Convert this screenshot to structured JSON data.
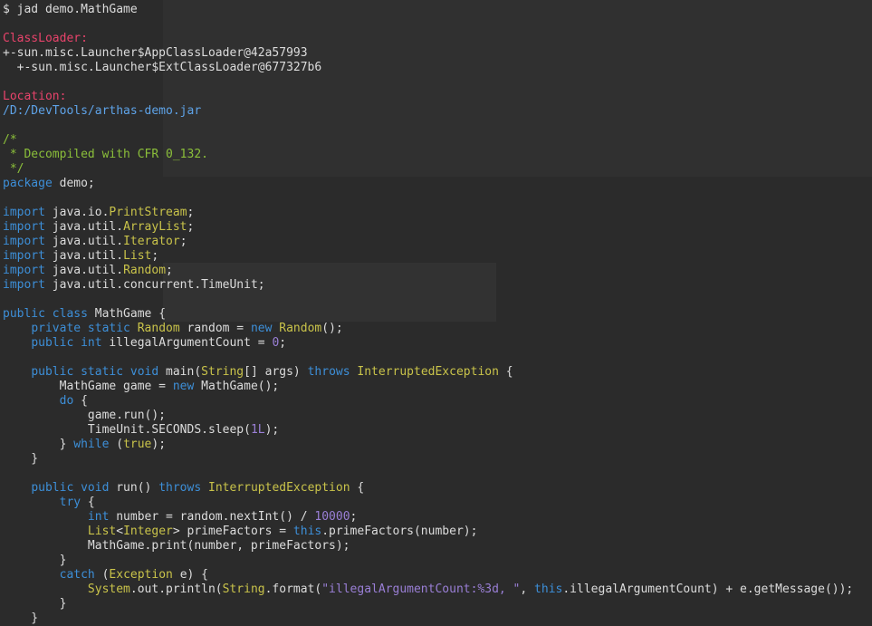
{
  "terminal": {
    "lines": [
      [
        {
          "t": "$ jad demo.MathGame",
          "c": "text"
        }
      ],
      [],
      [
        {
          "t": "ClassLoader:",
          "c": "label"
        }
      ],
      [
        {
          "t": "+-sun.misc.Launcher$AppClassLoader@42a57993",
          "c": "text"
        }
      ],
      [
        {
          "t": "  +-sun.misc.Launcher$ExtClassLoader@677327b6",
          "c": "text"
        }
      ],
      [],
      [
        {
          "t": "Location:",
          "c": "label"
        }
      ],
      [
        {
          "t": "/D:/DevTools/arthas-demo.jar",
          "c": "path"
        }
      ],
      [],
      [
        {
          "t": "/*",
          "c": "comment"
        }
      ],
      [
        {
          "t": " * Decompiled with CFR 0_132.",
          "c": "comment"
        }
      ],
      [
        {
          "t": " */",
          "c": "comment"
        }
      ],
      [
        {
          "t": "package",
          "c": "kw"
        },
        {
          "t": " demo;",
          "c": "text"
        }
      ],
      [],
      [
        {
          "t": "import",
          "c": "kw"
        },
        {
          "t": " java.io.",
          "c": "text"
        },
        {
          "t": "PrintStream",
          "c": "type"
        },
        {
          "t": ";",
          "c": "text"
        }
      ],
      [
        {
          "t": "import",
          "c": "kw"
        },
        {
          "t": " java.util.",
          "c": "text"
        },
        {
          "t": "ArrayList",
          "c": "type"
        },
        {
          "t": ";",
          "c": "text"
        }
      ],
      [
        {
          "t": "import",
          "c": "kw"
        },
        {
          "t": " java.util.",
          "c": "text"
        },
        {
          "t": "Iterator",
          "c": "type"
        },
        {
          "t": ";",
          "c": "text"
        }
      ],
      [
        {
          "t": "import",
          "c": "kw"
        },
        {
          "t": " java.util.",
          "c": "text"
        },
        {
          "t": "List",
          "c": "type"
        },
        {
          "t": ";",
          "c": "text"
        }
      ],
      [
        {
          "t": "import",
          "c": "kw"
        },
        {
          "t": " java.util.",
          "c": "text"
        },
        {
          "t": "Random",
          "c": "type"
        },
        {
          "t": ";",
          "c": "text"
        }
      ],
      [
        {
          "t": "import",
          "c": "kw"
        },
        {
          "t": " java.util.concurrent.TimeUnit;",
          "c": "text"
        }
      ],
      [],
      [
        {
          "t": "public class",
          "c": "kw"
        },
        {
          "t": " MathGame {",
          "c": "text"
        }
      ],
      [
        {
          "t": "    ",
          "c": "text"
        },
        {
          "t": "private static",
          "c": "kw"
        },
        {
          "t": " ",
          "c": "text"
        },
        {
          "t": "Random",
          "c": "type"
        },
        {
          "t": " random = ",
          "c": "text"
        },
        {
          "t": "new",
          "c": "kw"
        },
        {
          "t": " ",
          "c": "text"
        },
        {
          "t": "Random",
          "c": "type"
        },
        {
          "t": "();",
          "c": "text"
        }
      ],
      [
        {
          "t": "    ",
          "c": "text"
        },
        {
          "t": "public int",
          "c": "kw"
        },
        {
          "t": " illegalArgumentCount = ",
          "c": "text"
        },
        {
          "t": "0",
          "c": "num"
        },
        {
          "t": ";",
          "c": "text"
        }
      ],
      [],
      [
        {
          "t": "    ",
          "c": "text"
        },
        {
          "t": "public static void",
          "c": "kw"
        },
        {
          "t": " main(",
          "c": "text"
        },
        {
          "t": "String",
          "c": "type"
        },
        {
          "t": "[] args) ",
          "c": "text"
        },
        {
          "t": "throws",
          "c": "kw"
        },
        {
          "t": " ",
          "c": "text"
        },
        {
          "t": "InterruptedException",
          "c": "type"
        },
        {
          "t": " {",
          "c": "text"
        }
      ],
      [
        {
          "t": "        MathGame game = ",
          "c": "text"
        },
        {
          "t": "new",
          "c": "kw"
        },
        {
          "t": " MathGame();",
          "c": "text"
        }
      ],
      [
        {
          "t": "        ",
          "c": "text"
        },
        {
          "t": "do",
          "c": "kw"
        },
        {
          "t": " {",
          "c": "text"
        }
      ],
      [
        {
          "t": "            game.run();",
          "c": "text"
        }
      ],
      [
        {
          "t": "            TimeUnit.SECONDS.sleep(",
          "c": "text"
        },
        {
          "t": "1L",
          "c": "num"
        },
        {
          "t": ");",
          "c": "text"
        }
      ],
      [
        {
          "t": "        } ",
          "c": "text"
        },
        {
          "t": "while",
          "c": "kw"
        },
        {
          "t": " (",
          "c": "text"
        },
        {
          "t": "true",
          "c": "type"
        },
        {
          "t": ");",
          "c": "text"
        }
      ],
      [
        {
          "t": "    }",
          "c": "text"
        }
      ],
      [],
      [
        {
          "t": "    ",
          "c": "text"
        },
        {
          "t": "public void",
          "c": "kw"
        },
        {
          "t": " run() ",
          "c": "text"
        },
        {
          "t": "throws",
          "c": "kw"
        },
        {
          "t": " ",
          "c": "text"
        },
        {
          "t": "InterruptedException",
          "c": "type"
        },
        {
          "t": " {",
          "c": "text"
        }
      ],
      [
        {
          "t": "        ",
          "c": "text"
        },
        {
          "t": "try",
          "c": "kw"
        },
        {
          "t": " {",
          "c": "text"
        }
      ],
      [
        {
          "t": "            ",
          "c": "text"
        },
        {
          "t": "int",
          "c": "kw"
        },
        {
          "t": " number = random.nextInt() / ",
          "c": "text"
        },
        {
          "t": "10000",
          "c": "num"
        },
        {
          "t": ";",
          "c": "text"
        }
      ],
      [
        {
          "t": "            ",
          "c": "text"
        },
        {
          "t": "List",
          "c": "type"
        },
        {
          "t": "<",
          "c": "text"
        },
        {
          "t": "Integer",
          "c": "type"
        },
        {
          "t": "> primeFactors = ",
          "c": "text"
        },
        {
          "t": "this",
          "c": "kw"
        },
        {
          "t": ".primeFactors(number);",
          "c": "text"
        }
      ],
      [
        {
          "t": "            MathGame.print(number, primeFactors);",
          "c": "text"
        }
      ],
      [
        {
          "t": "        }",
          "c": "text"
        }
      ],
      [
        {
          "t": "        ",
          "c": "text"
        },
        {
          "t": "catch",
          "c": "kw"
        },
        {
          "t": " (",
          "c": "text"
        },
        {
          "t": "Exception",
          "c": "type"
        },
        {
          "t": " e) {",
          "c": "text"
        }
      ],
      [
        {
          "t": "            ",
          "c": "text"
        },
        {
          "t": "System",
          "c": "type"
        },
        {
          "t": ".out.println(",
          "c": "text"
        },
        {
          "t": "String",
          "c": "type"
        },
        {
          "t": ".format(",
          "c": "text"
        },
        {
          "t": "\"illegalArgumentCount:%3d, \"",
          "c": "str"
        },
        {
          "t": ", ",
          "c": "text"
        },
        {
          "t": "this",
          "c": "kw"
        },
        {
          "t": ".illegalArgumentCount) + e.getMessage());",
          "c": "text"
        }
      ],
      [
        {
          "t": "        }",
          "c": "text"
        }
      ],
      [
        {
          "t": "    }",
          "c": "text"
        }
      ]
    ]
  }
}
